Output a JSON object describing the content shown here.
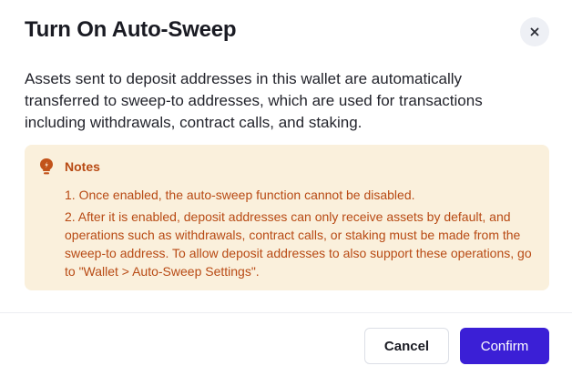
{
  "dialog": {
    "title": "Turn On Auto-Sweep",
    "description": "Assets sent to deposit addresses in this wallet are automatically transferred to sweep-to addresses, which are used for transactions including withdrawals, contract calls, and staking.",
    "close_icon": "close-icon"
  },
  "notes": {
    "icon": "lightbulb-icon",
    "title": "Notes",
    "items": [
      "1. Once enabled, the auto-sweep function cannot be disabled.",
      "2. After it is enabled, deposit addresses can only receive assets by default, and operations such as withdrawals, contract calls, or staking must be made from the sweep-to address. To allow deposit addresses to also support these operations, go to \"Wallet > Auto-Sweep Settings\"."
    ]
  },
  "footer": {
    "cancel_label": "Cancel",
    "confirm_label": "Confirm"
  },
  "colors": {
    "accent": "#3b1fd6",
    "notes_background": "#faf0dc",
    "notes_text": "#b84a14"
  }
}
